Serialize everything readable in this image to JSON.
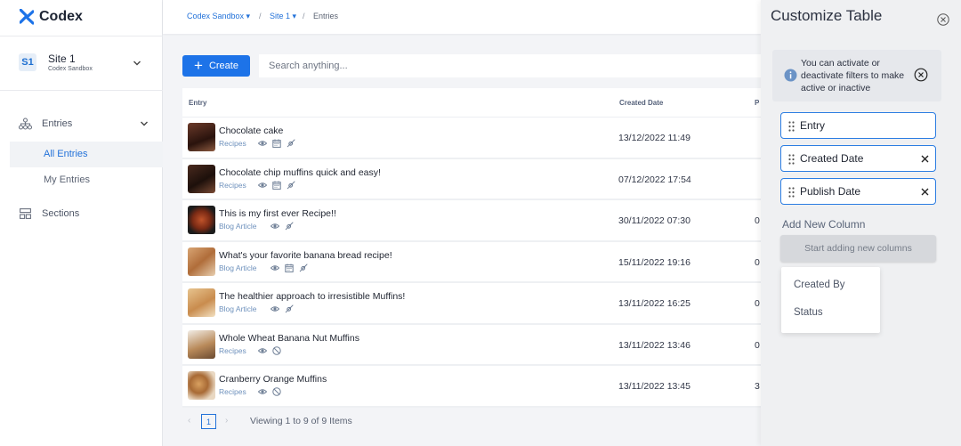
{
  "app": {
    "name": "Codex"
  },
  "sidebar": {
    "site": {
      "badge": "S1",
      "name": "Site 1",
      "org": "Codex Sandbox"
    },
    "entries_label": "Entries",
    "sub_items": [
      {
        "label": "All Entries",
        "active": true
      },
      {
        "label": "My Entries",
        "active": false
      }
    ],
    "sections_label": "Sections"
  },
  "breadcrumb": {
    "org": "Codex Sandbox",
    "site": "Site 1",
    "page": "Entries",
    "sep": "/"
  },
  "toolbar": {
    "create_label": "Create",
    "search_placeholder": "Search anything..."
  },
  "table": {
    "headers": {
      "entry": "Entry",
      "created": "Created Date",
      "publish": "P"
    },
    "rows": [
      {
        "title": "Chocolate cake",
        "type": "Recipes",
        "icons": [
          "eye-icon",
          "calendar-icon",
          "rocket-icon"
        ],
        "created": "13/12/2022 11:49",
        "publish": ""
      },
      {
        "title": "Chocolate chip muffins quick and easy!",
        "type": "Recipes",
        "icons": [
          "eye-icon",
          "calendar-icon",
          "rocket-icon"
        ],
        "created": "07/12/2022 17:54",
        "publish": ""
      },
      {
        "title": "This is my first ever Recipe!!",
        "type": "Blog Article",
        "icons": [
          "eye-icon",
          "rocket-icon"
        ],
        "created": "30/11/2022 07:30",
        "publish": "0"
      },
      {
        "title": "What's your favorite banana bread recipe!",
        "type": "Blog Article",
        "icons": [
          "eye-icon",
          "calendar-icon",
          "rocket-icon"
        ],
        "created": "15/11/2022 19:16",
        "publish": "0"
      },
      {
        "title": "The healthier approach to irresistible Muffins!",
        "type": "Blog Article",
        "icons": [
          "eye-icon",
          "rocket-icon"
        ],
        "created": "13/11/2022 16:25",
        "publish": "0"
      },
      {
        "title": "Whole Wheat Banana Nut Muffins",
        "type": "Recipes",
        "icons": [
          "eye-icon",
          "ban-icon"
        ],
        "created": "13/11/2022 13:46",
        "publish": "0"
      },
      {
        "title": "Cranberry Orange Muffins",
        "type": "Recipes",
        "icons": [
          "eye-icon",
          "ban-icon"
        ],
        "created": "13/11/2022 13:45",
        "publish": "3"
      }
    ]
  },
  "pagination": {
    "prev": "‹",
    "page": "1",
    "next": "›",
    "info": "Viewing 1 to 9 of 9 Items"
  },
  "customize": {
    "title": "Customize Table",
    "info": "You can activate or deactivate filters to make active or inactive",
    "columns": [
      {
        "label": "Entry",
        "removable": false
      },
      {
        "label": "Created Date",
        "removable": true
      },
      {
        "label": "Publish Date",
        "removable": true
      }
    ],
    "add_label": "Add New Column",
    "start_button": "Start adding new columns",
    "options": [
      "Created By",
      "Status"
    ]
  },
  "colors": {
    "accent": "#1d73e8",
    "link": "#2372d9",
    "panel_bg": "#eff0f2"
  }
}
